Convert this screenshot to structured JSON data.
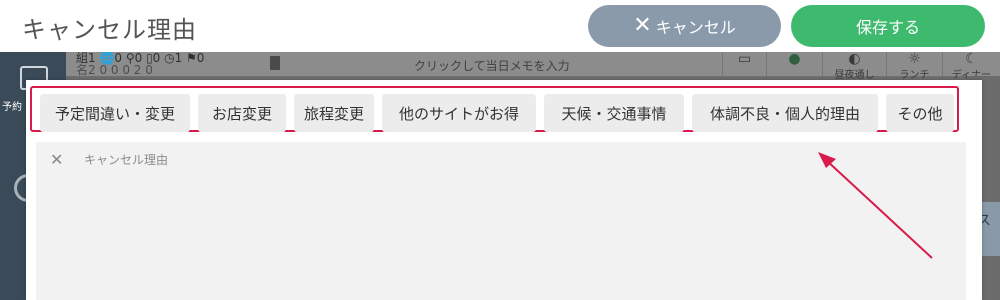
{
  "header": {
    "title": "キャンセル理由",
    "cancel_label": "キャンセル",
    "save_label": "保存する"
  },
  "background": {
    "left_label": "予約",
    "stats_row1": "組1 🌐0 ⚲0 ▯0 ◷1 ⚑0",
    "stats_row2": "名2   0   0   0   2   0",
    "memo_placeholder": "クリックして当日メモを入力",
    "tool1_label": "",
    "tool2_label": "",
    "tool3_label": "昼夜通し",
    "tool4_label": "ランチ",
    "tool5_label": "ディナー"
  },
  "reasons": [
    {
      "label": "予定間違い・変更"
    },
    {
      "label": "お店変更"
    },
    {
      "label": "旅程変更"
    },
    {
      "label": "他のサイトがお得"
    },
    {
      "label": "天候・交通事情"
    },
    {
      "label": "体調不良・個人的理由"
    },
    {
      "label": "その他"
    }
  ],
  "reason_field": {
    "placeholder": "キャンセル理由"
  },
  "colors": {
    "cancel_button": "#8a9aaa",
    "save_button": "#3dba6e",
    "highlight": "#d81b4a"
  }
}
